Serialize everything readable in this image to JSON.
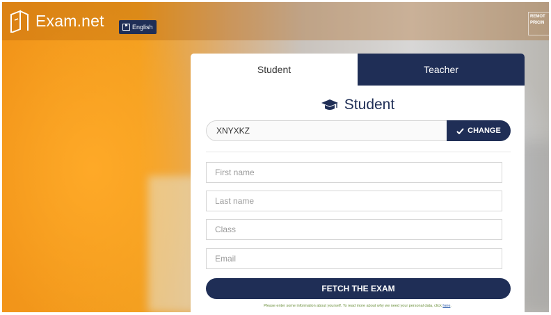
{
  "app": {
    "name": "Exam.net",
    "logo_icon": "exam-logo-icon"
  },
  "language_button": {
    "label": "English",
    "icon": "flag-icon"
  },
  "corner_text": {
    "line1": "REMOT",
    "line2": "PRICIN"
  },
  "tabs": [
    {
      "label": "Student",
      "active": true
    },
    {
      "label": "Teacher",
      "active": false
    }
  ],
  "form": {
    "heading": "Student",
    "heading_icon": "graduation-cap-icon",
    "exam_code": "XNYXKZ",
    "change_label": "CHANGE",
    "fields": [
      {
        "name": "first-name-field",
        "placeholder": "First name"
      },
      {
        "name": "last-name-field",
        "placeholder": "Last name"
      },
      {
        "name": "class-field",
        "placeholder": "Class"
      },
      {
        "name": "email-field",
        "placeholder": "Email"
      }
    ],
    "submit_label": "FETCH THE EXAM",
    "note_text": "Please enter some information about yourself. To read more about why we need your personal data, click",
    "note_link": "here"
  },
  "colors": {
    "navy": "#1f2e56",
    "orange": "#f29419"
  }
}
